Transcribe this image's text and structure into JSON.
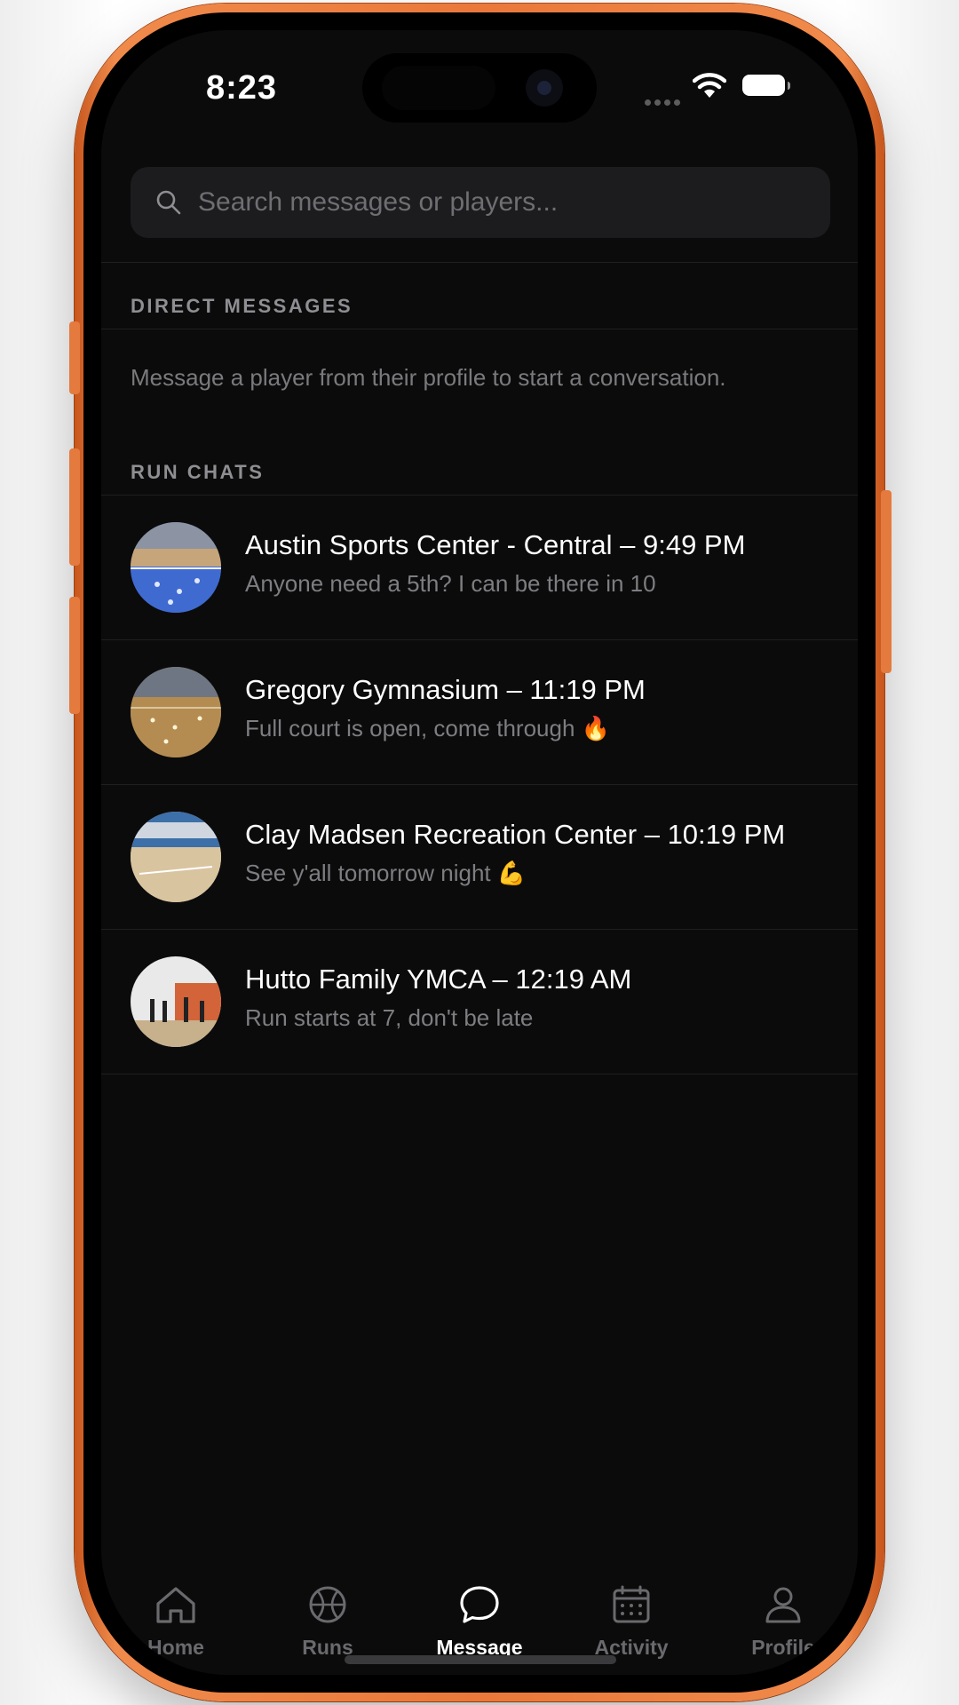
{
  "status_bar": {
    "time": "8:23"
  },
  "search": {
    "placeholder": "Search messages or players..."
  },
  "direct_messages": {
    "heading": "DIRECT MESSAGES",
    "empty_text": "Message a player from their profile to start a conversation."
  },
  "run_chats": {
    "heading": "RUN CHATS",
    "items": [
      {
        "title": "Austin Sports Center - Central – 9:49 PM",
        "preview": "Anyone need a 5th? I can be there in 10"
      },
      {
        "title": "Gregory Gymnasium – 11:19 PM",
        "preview": "Full court is open, come through 🔥"
      },
      {
        "title": "Clay Madsen Recreation Center – 10:19 PM",
        "preview": "See y'all tomorrow night 💪"
      },
      {
        "title": "Hutto Family YMCA – 12:19 AM",
        "preview": "Run starts at 7, don't be late"
      }
    ]
  },
  "tabs": [
    {
      "label": "Home",
      "icon": "home-icon"
    },
    {
      "label": "Runs",
      "icon": "basketball-icon"
    },
    {
      "label": "Message",
      "icon": "message-icon",
      "active": true
    },
    {
      "label": "Activity",
      "icon": "calendar-icon"
    },
    {
      "label": "Profile",
      "icon": "person-icon"
    }
  ],
  "colors": {
    "frame": "#e9783a",
    "background": "#0b0b0b",
    "text_primary": "#ffffff",
    "text_secondary": "#7d7d82"
  }
}
